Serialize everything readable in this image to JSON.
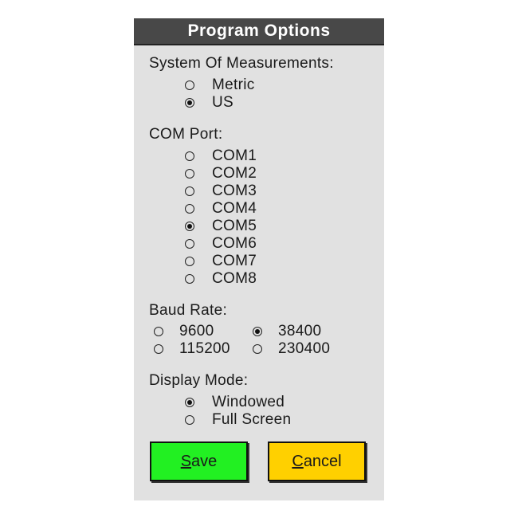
{
  "dialog": {
    "title": "Program Options"
  },
  "measurements": {
    "label": "System Of Measurements:",
    "options": [
      {
        "label": "Metric",
        "selected": false
      },
      {
        "label": "US",
        "selected": true
      }
    ]
  },
  "com_port": {
    "label": "COM Port:",
    "options": [
      {
        "label": "COM1",
        "selected": false
      },
      {
        "label": "COM2",
        "selected": false
      },
      {
        "label": "COM3",
        "selected": false
      },
      {
        "label": "COM4",
        "selected": false
      },
      {
        "label": "COM5",
        "selected": true
      },
      {
        "label": "COM6",
        "selected": false
      },
      {
        "label": "COM7",
        "selected": false
      },
      {
        "label": "COM8",
        "selected": false
      }
    ]
  },
  "baud_rate": {
    "label": "Baud Rate:",
    "options": [
      {
        "label": "9600",
        "selected": false
      },
      {
        "label": "38400",
        "selected": true
      },
      {
        "label": "115200",
        "selected": false
      },
      {
        "label": "230400",
        "selected": false
      }
    ]
  },
  "display_mode": {
    "label": "Display Mode:",
    "options": [
      {
        "label": "Windowed",
        "selected": true
      },
      {
        "label": "Full Screen",
        "selected": false
      }
    ]
  },
  "buttons": {
    "save": {
      "mnemonic": "S",
      "rest": "ave",
      "color": "#22f022"
    },
    "cancel": {
      "mnemonic": "C",
      "rest": "ancel",
      "color": "#ffd000"
    }
  }
}
